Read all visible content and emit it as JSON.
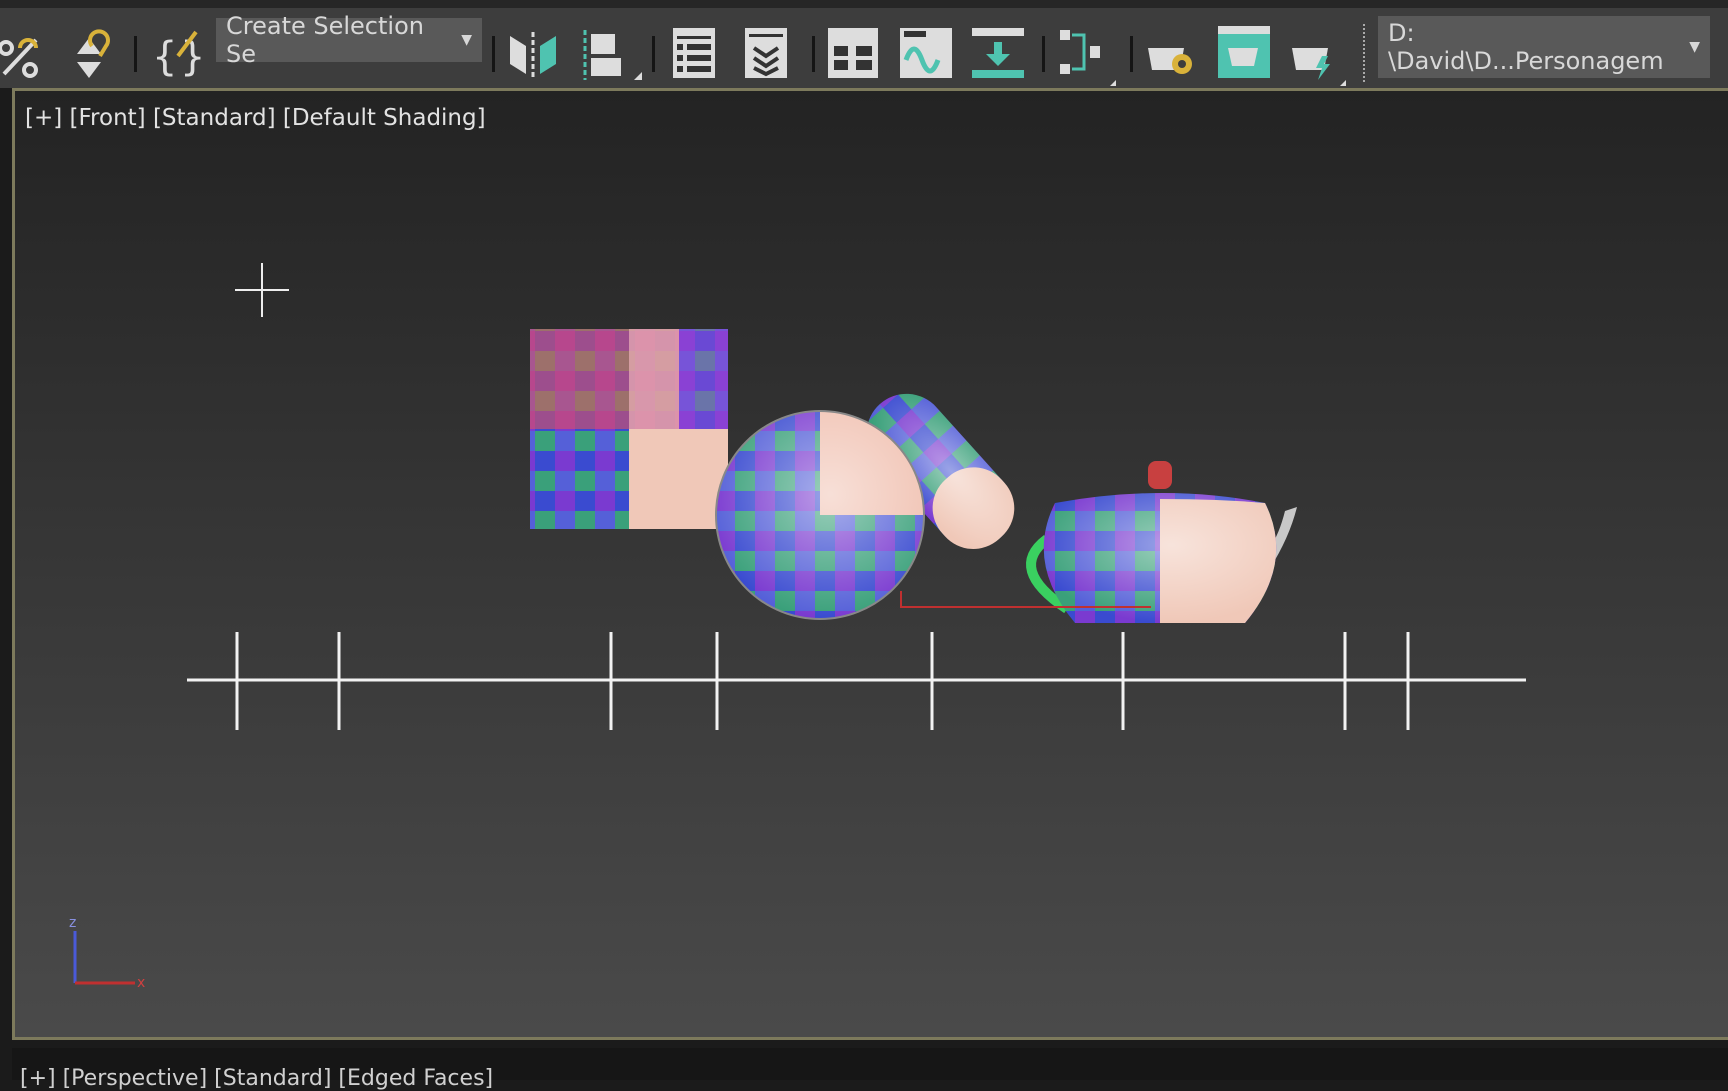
{
  "toolbar": {
    "selection_set": {
      "label": "Create Selection Se",
      "arrow": "▼"
    },
    "project_path": {
      "label": "D: \\David\\D...Personagem",
      "arrow": "▼"
    },
    "icons": [
      "percent-snap-icon",
      "spinner-snap-icon",
      "edit-named-selection-icon",
      "mirror-icon",
      "align-icon",
      "scene-explorer-icon",
      "layer-explorer-icon",
      "ribbon-icon",
      "curve-editor-icon",
      "dope-sheet-icon",
      "schematic-view-icon",
      "render-setup-icon",
      "rendered-frame-window-icon",
      "render-production-icon"
    ],
    "accent_color": "#4fc3b0"
  },
  "viewport": {
    "label": "[+] [Front] [Standard] [Default Shading]",
    "axis": {
      "z": "z",
      "x": "x"
    },
    "objects": [
      "plane",
      "sphere",
      "capsule",
      "teapot",
      "ground-spline"
    ]
  },
  "bottom_viewport": {
    "label": "[+] [Perspective] [Standard] [Edged Faces]"
  }
}
